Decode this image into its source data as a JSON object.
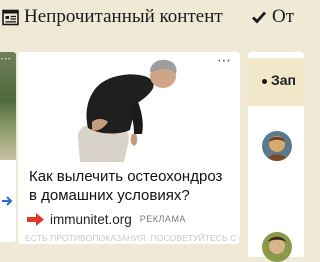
{
  "header": {
    "tab_unread_label": "Непрочитанный контент",
    "tab_other_label": "От"
  },
  "ad": {
    "title": "Как вылечить остеохондроз в домашних условиях?",
    "domain": "immunitet.org",
    "label": "РЕКЛАМА",
    "disclaimer": "ЕСТЬ ПРОТИВОПОКАЗАНИЯ. ПОСОВЕТУЙТЕСЬ С ВРАЧОМ"
  },
  "sidebar": {
    "header_text": "Зап"
  },
  "icons": {
    "unread": "document-icon",
    "other": "checkmark-icon",
    "ad_source": "arrow-right-icon",
    "menu": "more-dots-icon"
  },
  "colors": {
    "page_background": "#efe9d6",
    "card_background": "#ffffff",
    "ad_arrow": "#e2382b",
    "sidebar_header": "#f2e7c9"
  }
}
